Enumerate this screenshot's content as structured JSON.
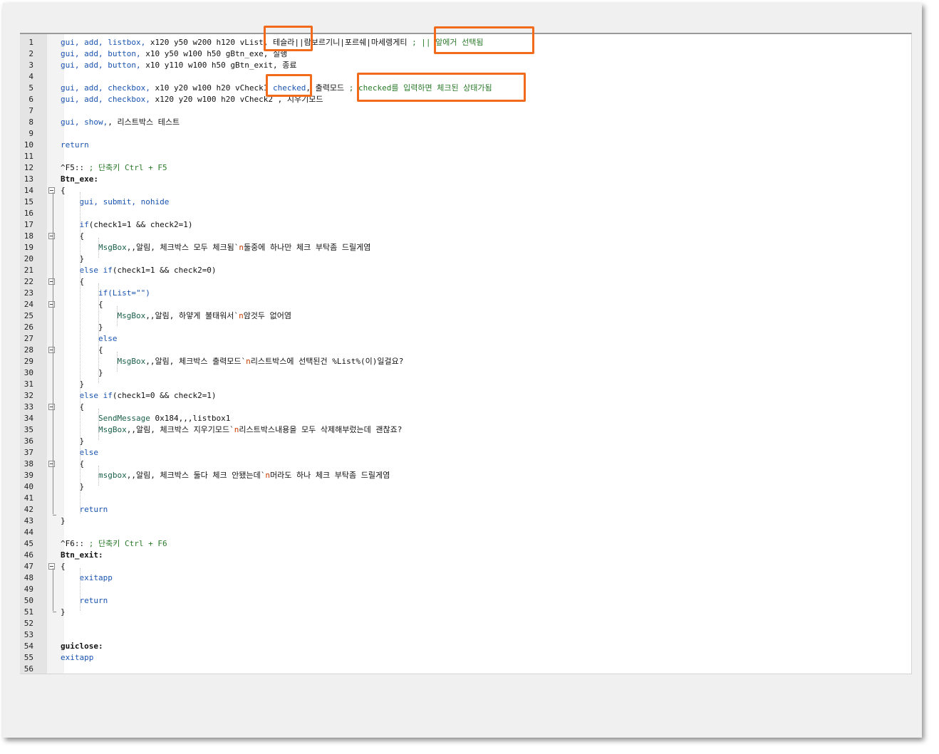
{
  "editor": {
    "lines": [
      {
        "n": "1",
        "segs": [
          [
            "kw",
            "gui, add, listbox, "
          ],
          [
            "txt",
            "x120 y50 w200 h120 vList, 테슬라||람보르기니|포르쉐|마세렝게티 "
          ],
          [
            "cm",
            "; || 앞에거 선택됨"
          ]
        ]
      },
      {
        "n": "2",
        "segs": [
          [
            "kw",
            "gui, add, button, "
          ],
          [
            "txt",
            "x10 y50 w100 h50 gBtn_exe, 실행"
          ]
        ]
      },
      {
        "n": "3",
        "segs": [
          [
            "kw",
            "gui, add, button, "
          ],
          [
            "txt",
            "x10 y110 w100 h50 gBtn_exit, 종료"
          ]
        ]
      },
      {
        "n": "4",
        "segs": []
      },
      {
        "n": "5",
        "segs": [
          [
            "kw",
            "gui, add, checkbox, "
          ],
          [
            "txt",
            "x10 y20 w100 h20 vCheck1 "
          ],
          [
            "kw",
            "checked"
          ],
          [
            "txt",
            ", 출력모드 "
          ],
          [
            "cm",
            "; checked를 입력하면 체크된 상태가됨"
          ]
        ]
      },
      {
        "n": "6",
        "segs": [
          [
            "kw",
            "gui, add, checkbox, "
          ],
          [
            "txt",
            "x120 y20 w100 h20 vCheck2 , 지우기모드"
          ]
        ]
      },
      {
        "n": "7",
        "segs": []
      },
      {
        "n": "8",
        "segs": [
          [
            "kw",
            "gui, show,"
          ],
          [
            "txt",
            ", 리스트박스 테스트"
          ]
        ]
      },
      {
        "n": "9",
        "segs": []
      },
      {
        "n": "10",
        "segs": [
          [
            "kw",
            "return"
          ]
        ]
      },
      {
        "n": "11",
        "segs": []
      },
      {
        "n": "12",
        "segs": [
          [
            "txt",
            "^F5:: "
          ],
          [
            "cm",
            "; 단축키 Ctrl + F5"
          ]
        ]
      },
      {
        "n": "13",
        "segs": [
          [
            "bold",
            "Btn_exe:"
          ]
        ]
      },
      {
        "n": "14",
        "segs": [
          [
            "txt",
            "{"
          ]
        ]
      },
      {
        "n": "15",
        "segs": [
          [
            "txt",
            "    "
          ],
          [
            "kw",
            "gui, submit, nohide"
          ]
        ]
      },
      {
        "n": "16",
        "segs": []
      },
      {
        "n": "17",
        "segs": [
          [
            "txt",
            "    "
          ],
          [
            "kw",
            "if"
          ],
          [
            "txt",
            "(check1=1 && check2=1)"
          ]
        ]
      },
      {
        "n": "18",
        "segs": [
          [
            "txt",
            "    {"
          ]
        ]
      },
      {
        "n": "19",
        "segs": [
          [
            "txt",
            "        "
          ],
          [
            "id",
            "MsgBox"
          ],
          [
            "txt",
            ",,알림, 체크박스 모두 체크됨`"
          ],
          [
            "esc",
            "n"
          ],
          [
            "txt",
            "둘중에 하나만 체크 부탁좀 드릴게염"
          ]
        ]
      },
      {
        "n": "20",
        "segs": [
          [
            "txt",
            "    }"
          ]
        ]
      },
      {
        "n": "21",
        "segs": [
          [
            "txt",
            "    "
          ],
          [
            "kw",
            "else if"
          ],
          [
            "txt",
            "(check1=1 && check2=0)"
          ]
        ]
      },
      {
        "n": "22",
        "segs": [
          [
            "txt",
            "    {"
          ]
        ]
      },
      {
        "n": "23",
        "segs": [
          [
            "txt",
            "        "
          ],
          [
            "kw",
            "if(List=\"\")"
          ]
        ]
      },
      {
        "n": "24",
        "segs": [
          [
            "txt",
            "        {"
          ]
        ]
      },
      {
        "n": "25",
        "segs": [
          [
            "txt",
            "            "
          ],
          [
            "id",
            "MsgBox"
          ],
          [
            "txt",
            ",,알림, 하얗게 불태워서`"
          ],
          [
            "esc",
            "n"
          ],
          [
            "txt",
            "암것두 없어염"
          ]
        ]
      },
      {
        "n": "26",
        "segs": [
          [
            "txt",
            "        }"
          ]
        ]
      },
      {
        "n": "27",
        "segs": [
          [
            "txt",
            "        "
          ],
          [
            "kw",
            "else"
          ]
        ]
      },
      {
        "n": "28",
        "segs": [
          [
            "txt",
            "        {"
          ]
        ]
      },
      {
        "n": "29",
        "segs": [
          [
            "txt",
            "            "
          ],
          [
            "id",
            "MsgBox"
          ],
          [
            "txt",
            ",,알림, 체크박스 출력모드`"
          ],
          [
            "esc",
            "n"
          ],
          [
            "txt",
            "리스트박스에 선택된건 %List%(이)일걸요?"
          ]
        ]
      },
      {
        "n": "30",
        "segs": [
          [
            "txt",
            "        }"
          ]
        ]
      },
      {
        "n": "31",
        "segs": [
          [
            "txt",
            "    }"
          ]
        ]
      },
      {
        "n": "32",
        "segs": [
          [
            "txt",
            "    "
          ],
          [
            "kw",
            "else if"
          ],
          [
            "txt",
            "(check1=0 && check2=1)"
          ]
        ]
      },
      {
        "n": "33",
        "segs": [
          [
            "txt",
            "    {"
          ]
        ]
      },
      {
        "n": "34",
        "segs": [
          [
            "txt",
            "        "
          ],
          [
            "id",
            "SendMessage"
          ],
          [
            "txt",
            " 0x184,,,listbox1"
          ]
        ]
      },
      {
        "n": "35",
        "segs": [
          [
            "txt",
            "        "
          ],
          [
            "id",
            "MsgBox"
          ],
          [
            "txt",
            ",,알림, 체크박스 지우기모드`"
          ],
          [
            "esc",
            "n"
          ],
          [
            "txt",
            "리스트박스내용을 모두 삭제해부렀는데 괜찮죠?"
          ]
        ]
      },
      {
        "n": "36",
        "segs": [
          [
            "txt",
            "    }"
          ]
        ]
      },
      {
        "n": "37",
        "segs": [
          [
            "txt",
            "    "
          ],
          [
            "kw",
            "else"
          ]
        ]
      },
      {
        "n": "38",
        "segs": [
          [
            "txt",
            "    {"
          ]
        ]
      },
      {
        "n": "39",
        "segs": [
          [
            "txt",
            "        "
          ],
          [
            "id",
            "msgbox"
          ],
          [
            "txt",
            ",,알림, 체크박스 둘다 체크 안됐는데`"
          ],
          [
            "esc",
            "n"
          ],
          [
            "txt",
            "머라도 하나 체크 부탁좀 드릴게염"
          ]
        ]
      },
      {
        "n": "40",
        "segs": [
          [
            "txt",
            "    }"
          ]
        ]
      },
      {
        "n": "41",
        "segs": []
      },
      {
        "n": "42",
        "segs": [
          [
            "txt",
            "    "
          ],
          [
            "kw",
            "return"
          ]
        ]
      },
      {
        "n": "43",
        "segs": [
          [
            "txt",
            "}"
          ]
        ]
      },
      {
        "n": "44",
        "segs": []
      },
      {
        "n": "45",
        "segs": [
          [
            "txt",
            "^F6:: "
          ],
          [
            "cm",
            "; 단축키 Ctrl + F6"
          ]
        ]
      },
      {
        "n": "46",
        "segs": [
          [
            "bold",
            "Btn_exit:"
          ]
        ]
      },
      {
        "n": "47",
        "segs": [
          [
            "txt",
            "{"
          ]
        ]
      },
      {
        "n": "48",
        "segs": [
          [
            "txt",
            "    "
          ],
          [
            "kw",
            "exitapp"
          ]
        ]
      },
      {
        "n": "49",
        "segs": []
      },
      {
        "n": "50",
        "segs": [
          [
            "txt",
            "    "
          ],
          [
            "kw",
            "return"
          ]
        ]
      },
      {
        "n": "51",
        "segs": [
          [
            "txt",
            "}"
          ]
        ]
      },
      {
        "n": "52",
        "segs": []
      },
      {
        "n": "53",
        "segs": []
      },
      {
        "n": "54",
        "segs": [
          [
            "bold",
            "guiclose:"
          ]
        ]
      },
      {
        "n": "55",
        "segs": [
          [
            "kw",
            "exitapp"
          ]
        ]
      },
      {
        "n": "56",
        "segs": []
      }
    ]
  },
  "colors": {
    "keyword": "#1a53b0",
    "comment": "#2a7a2a",
    "escape": "#c83c00",
    "highlight_box": "#f26a1b"
  }
}
